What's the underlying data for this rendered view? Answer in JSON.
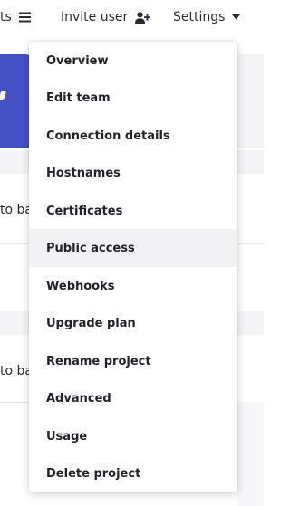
{
  "topbar": {
    "partial_nav_label": "ts",
    "partial_nav_icon": "list-icon",
    "invite_label": "Invite user",
    "invite_icon": "user-plus-icon",
    "settings_label": "Settings",
    "settings_icon": "caret-down-icon"
  },
  "background": {
    "row_1_text": "to ba",
    "row_2_text": "to ba",
    "accent_color": "#4451c5"
  },
  "menu": {
    "hovered_item": "Public access",
    "items": [
      {
        "label": "Overview"
      },
      {
        "label": "Edit team"
      },
      {
        "label": "Connection details"
      },
      {
        "label": "Hostnames"
      },
      {
        "label": "Certificates"
      },
      {
        "label": "Public access"
      },
      {
        "label": "Webhooks"
      },
      {
        "label": "Upgrade plan"
      },
      {
        "label": "Rename project"
      },
      {
        "label": "Advanced"
      },
      {
        "label": "Usage"
      },
      {
        "label": "Delete project"
      }
    ]
  }
}
